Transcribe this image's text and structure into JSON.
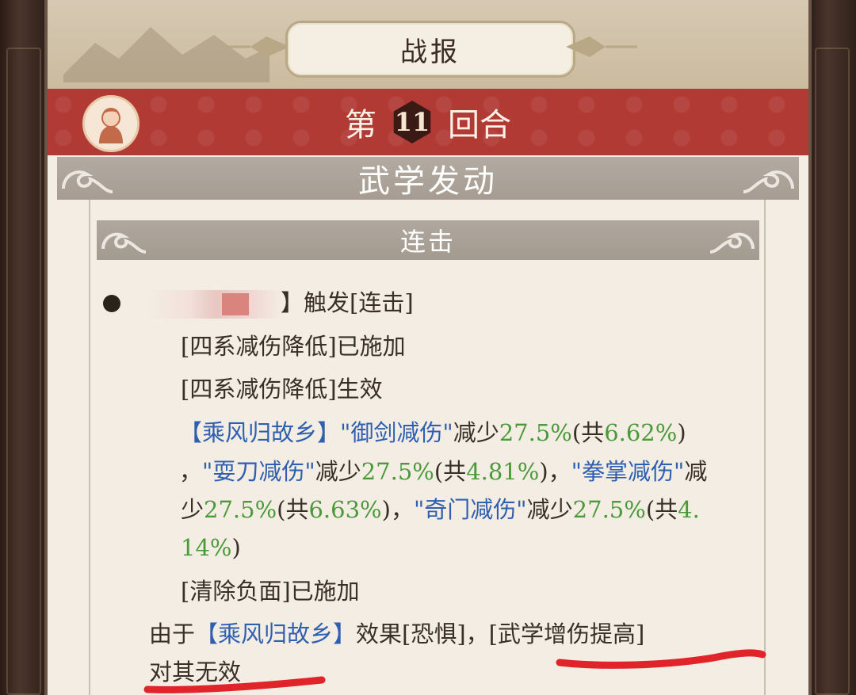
{
  "header": {
    "title": "战报"
  },
  "round": {
    "prefix": "第",
    "number": "11",
    "suffix": "回合"
  },
  "section": {
    "title": "武学发动"
  },
  "subsection": {
    "title": "连击"
  },
  "log": {
    "trigger_suffix": "】触发[连击]",
    "line_applied": "[四系减伤降低]已施加",
    "line_effective": "[四系减伤降低]生效",
    "skill_name": "【乘风归故乡】",
    "effect_1_name": "\"御剑减伤\"",
    "reduce_word": "减少",
    "percent": "27.5%",
    "total_open": "(共",
    "effect_1_total": "6.62%",
    "total_close": ")",
    "comma": "，",
    "effect_2_name": "\"耍刀减伤\"",
    "effect_2_total": "4.81%",
    "effect_3_name": "\"拳掌减伤\"",
    "reduce_word_a": "减",
    "reduce_word_b": "少",
    "effect_3_total": "6.63%",
    "effect_4_name": "\"奇门减伤\"",
    "effect_4_total_a": "4.",
    "effect_4_total_b": "14%",
    "line_cleanse": "[清除负面]已施加",
    "because": "由于",
    "effect_word": "效果[恐惧]，",
    "buff_name": "[武学增伤提高]",
    "invalid": "对其无效"
  },
  "colors": {
    "banner_red": "#b13a35",
    "skill_blue": "#2f5fb0",
    "value_green": "#4b9a3a",
    "annotation_red": "#e0242a"
  }
}
